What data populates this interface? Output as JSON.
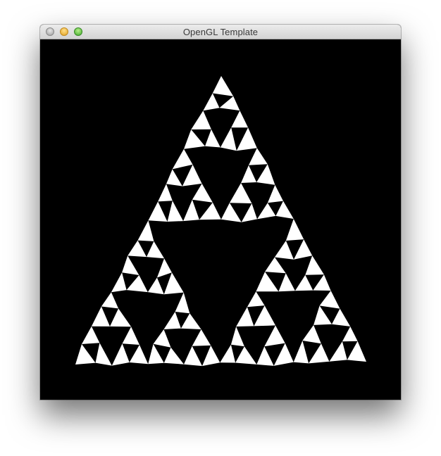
{
  "window": {
    "title": "OpenGL Template",
    "controls": [
      "close",
      "minimize",
      "zoom"
    ]
  },
  "canvas": {
    "background": "#000000",
    "fill": "#ffffff",
    "content": "sierpinski-triangle-render"
  },
  "colors": {
    "titlebar_top": "#ececec",
    "titlebar_bottom": "#d3d3d3",
    "title_text": "#3a3a3a",
    "close": "#b4b4b4",
    "minimize": "#f2b434",
    "zoom": "#5cc43a"
  }
}
